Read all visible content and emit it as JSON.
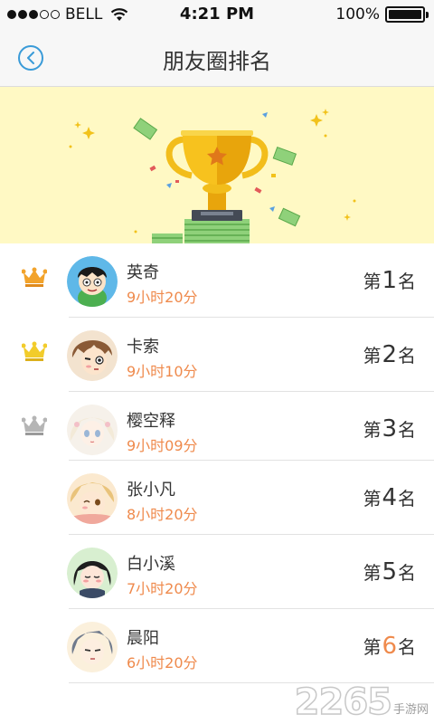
{
  "status_bar": {
    "carrier": "BELL",
    "time": "4:21 PM",
    "battery": "100%"
  },
  "nav": {
    "title": "朋友圈排名"
  },
  "rank_prefix": "第",
  "rank_suffix": "名",
  "colors": {
    "accent_orange": "#ef8a4c",
    "back_blue": "#3a9bd8",
    "banner_bg": "#fff9c4"
  },
  "list": [
    {
      "name": "英奇",
      "time": "9小时20分",
      "rank": "1",
      "crown": "gold-crown-icon"
    },
    {
      "name": "卡索",
      "time": "9小时10分",
      "rank": "2",
      "crown": "yellow-crown-icon"
    },
    {
      "name": "樱空释",
      "time": "9小时09分",
      "rank": "3",
      "crown": "silver-crown-icon"
    },
    {
      "name": "张小凡",
      "time": "8小时20分",
      "rank": "4",
      "crown": ""
    },
    {
      "name": "白小溪",
      "time": "7小时20分",
      "rank": "5",
      "crown": ""
    },
    {
      "name": "晨阳",
      "time": "6小时20分",
      "rank": "6",
      "crown": ""
    }
  ],
  "watermark": {
    "number": "2265",
    "text": "手游网"
  }
}
